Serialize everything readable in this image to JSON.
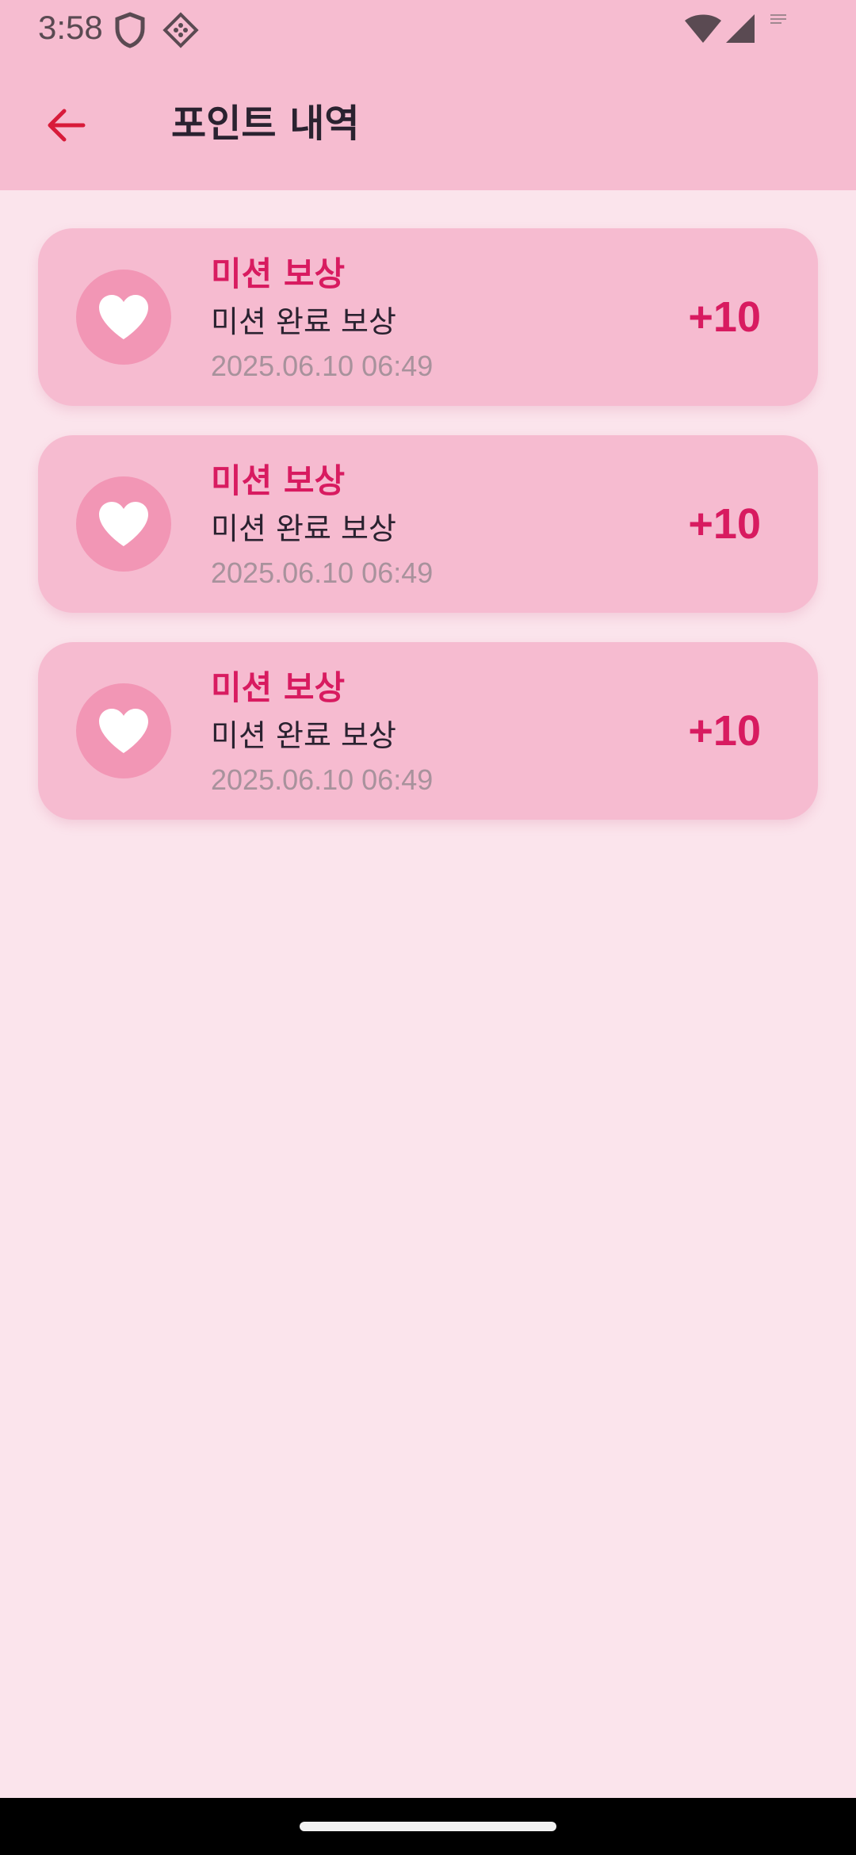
{
  "status_bar": {
    "time": "3:58",
    "icons": [
      "shield-icon",
      "vpn-key-icon",
      "wifi-icon",
      "cell-signal-icon",
      "notification-icon"
    ]
  },
  "header": {
    "title": "포인트 내역",
    "back_icon": "arrow-left-icon"
  },
  "colors": {
    "accent": "#d81b60",
    "card": "#f6bbd0",
    "icon_circle": "#f296b5",
    "background": "#fbe4ec",
    "appbar": "#f6bcd0"
  },
  "history": [
    {
      "icon": "heart-icon",
      "title": "미션 보상",
      "description": "미션 완료 보상",
      "date": "2025.06.10 06:49",
      "points": "+10"
    },
    {
      "icon": "heart-icon",
      "title": "미션 보상",
      "description": "미션 완료 보상",
      "date": "2025.06.10 06:49",
      "points": "+10"
    },
    {
      "icon": "heart-icon",
      "title": "미션 보상",
      "description": "미션 완료 보상",
      "date": "2025.06.10 06:49",
      "points": "+10"
    }
  ]
}
